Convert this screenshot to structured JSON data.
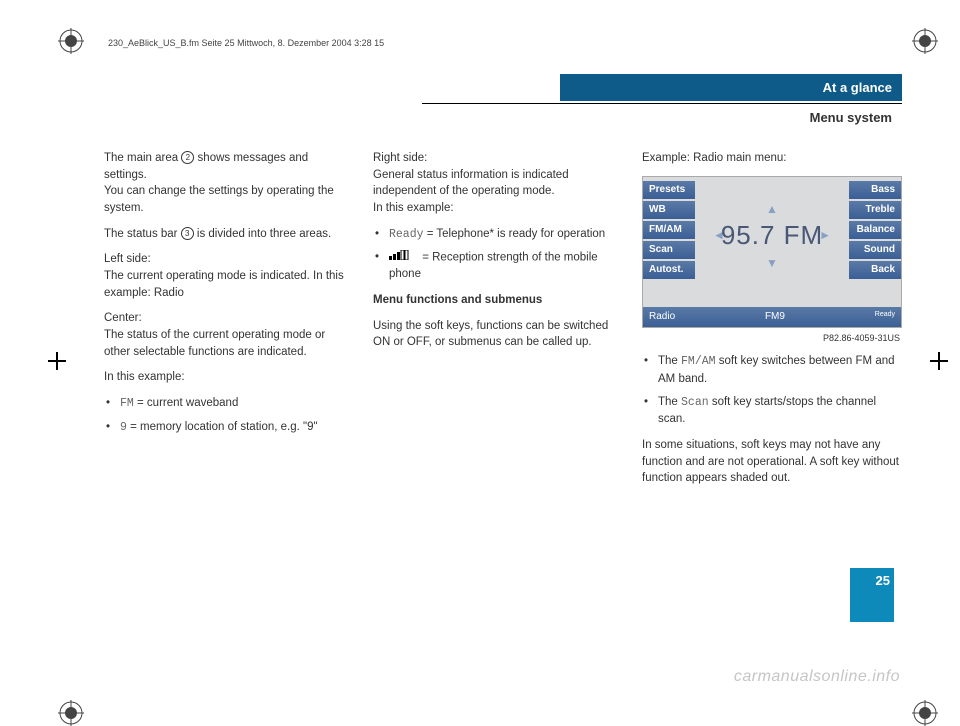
{
  "print_header": "230_AeBlick_US_B.fm  Seite 25  Mittwoch, 8. Dezember 2004  3:28 15",
  "header": {
    "title": "At a glance",
    "subtitle": "Menu system"
  },
  "col1": {
    "p1a": "The main area ",
    "circ2": "2",
    "p1b": " shows messages and settings.",
    "p2": "You can change the settings by operating the system.",
    "p3a": "The status bar ",
    "circ3": "3",
    "p3b": " is divided into three areas.",
    "left_lbl": "Left side:",
    "left_txt": "The current operating mode is indicated. In this example: Radio",
    "center_lbl": "Center:",
    "center_txt": "The status of the current operating mode or other selectable functions are indicated.",
    "example_lbl": "In this example:",
    "b1_code": "FM",
    "b1_txt": " = current waveband",
    "b2_code": "9",
    "b2_txt": " = memory location of station, e.g. \"9\""
  },
  "col2": {
    "right_lbl": "Right side:",
    "right_txt": "General status information is indicated independent of the operating mode.",
    "ex_lbl": "In this example:",
    "b1_code": "Ready",
    "b1_txt": " = Telephone* is ready for operation",
    "b2_txt": " = Reception strength of the mobile phone",
    "sub_head": "Menu functions and submenus",
    "sub_txt": "Using the soft keys, functions can be switched ON or OFF, or submenus can be called up."
  },
  "col3": {
    "ex_lbl": "Example: Radio main menu:",
    "softkeys_left": [
      "Presets",
      "WB",
      "FM/AM",
      "Scan",
      "Autost."
    ],
    "softkeys_right": [
      "Bass",
      "Treble",
      "Balance",
      "Sound",
      "Back"
    ],
    "freq": "95.7  FM",
    "status_left": "Radio",
    "status_mid": "FM9",
    "status_right": "Ready",
    "fig_id": "P82.86-4059-31US",
    "b1a": "The ",
    "b1_code": "FM/AM",
    "b1b": " soft key switches between FM and AM band.",
    "b2a": "The ",
    "b2_code": "Scan",
    "b2b": " soft key starts/stops the channel scan.",
    "note": "In some situations, soft keys may not have any function and are not operational. A soft key without function appears shaded out."
  },
  "page_number": "25",
  "watermark": "carmanualsonline.info"
}
